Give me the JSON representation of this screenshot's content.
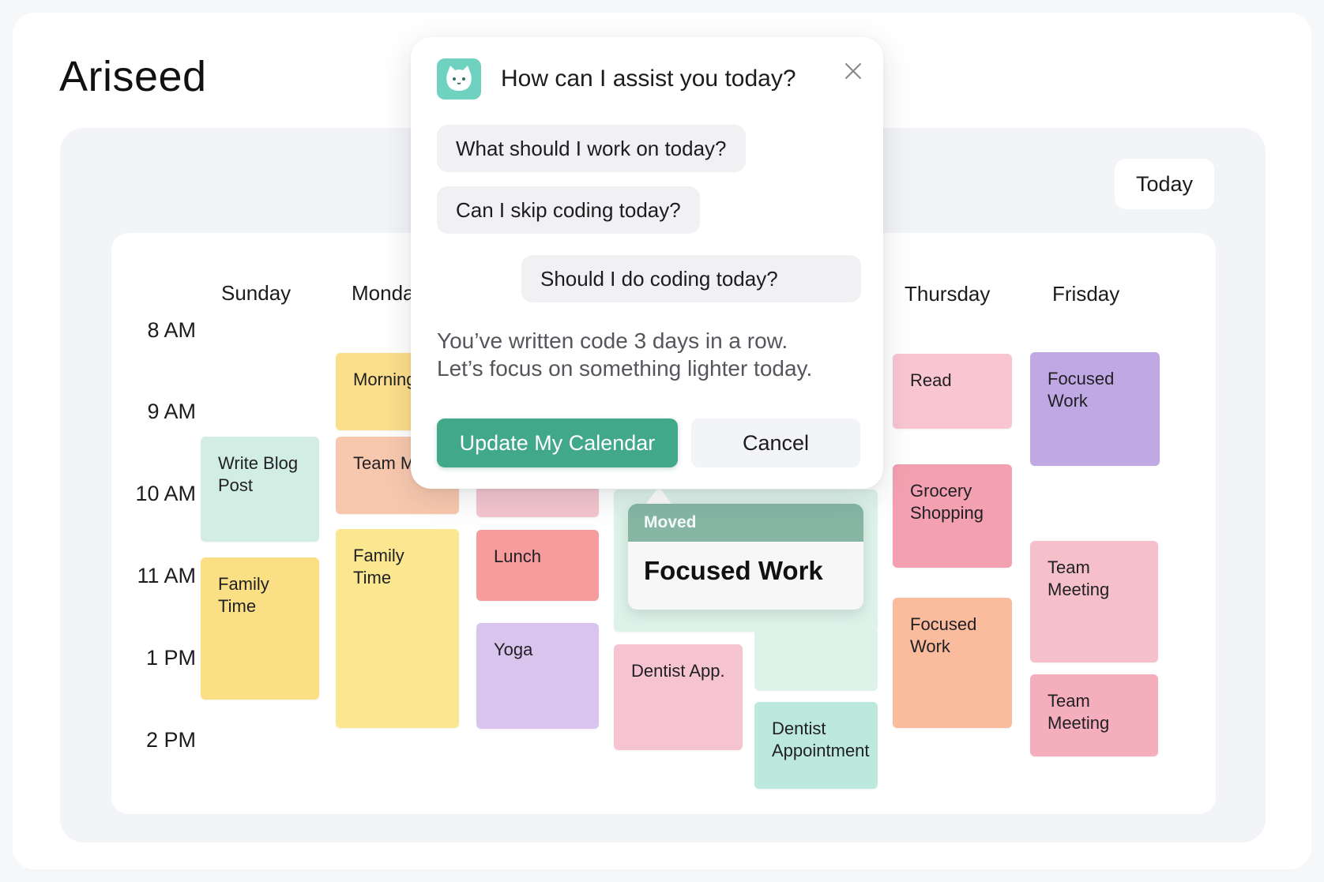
{
  "app": {
    "title": "Ariseed"
  },
  "toolbar": {
    "today_label": "Today"
  },
  "calendar": {
    "days": [
      "Sunday",
      "Monda",
      "Thursday",
      "Frisday"
    ],
    "times": [
      "8 AM",
      "9 AM",
      "10 AM",
      "11 AM",
      "1 PM",
      "2 PM"
    ],
    "events": {
      "sun_write": [
        "Write Blog",
        "Post"
      ],
      "sun_family": "Family Time",
      "mon_morning": "Morning",
      "mon_team": "Team Ma",
      "mon_family": "Family Time",
      "tue_lunch": "Lunch",
      "tue_yoga": "Yoga",
      "wed_dentist": "Dentist App.",
      "wed_dentist2": [
        "Dentist",
        "Appointment"
      ],
      "thu_read": "Read",
      "thu_grocery": [
        "Grocery",
        "Shopping"
      ],
      "thu_focused": [
        "Focused",
        "Work"
      ],
      "fri_focused": "Focused Work",
      "fri_team1": "Team Meeting",
      "fri_team2": "Team Meeting"
    },
    "moved": {
      "tag": "Moved",
      "title": "Focused Work"
    }
  },
  "assistant": {
    "title": "How can I assist you today?",
    "suggestions": [
      "What should I work on today?",
      "Can I skip coding today?"
    ],
    "user_message": "Should I do coding today?",
    "reply_lines": [
      "You’ve written code 3 days in a row.",
      "Let’s focus on something lighter today."
    ],
    "primary_button": "Update My Calendar",
    "secondary_button": "Cancel"
  },
  "colors": {
    "accent": "#42a88a",
    "logo": "#6fd1c0",
    "moved_header": "#87b6a5"
  },
  "icons": [
    "cat-face-icon",
    "close-icon"
  ]
}
